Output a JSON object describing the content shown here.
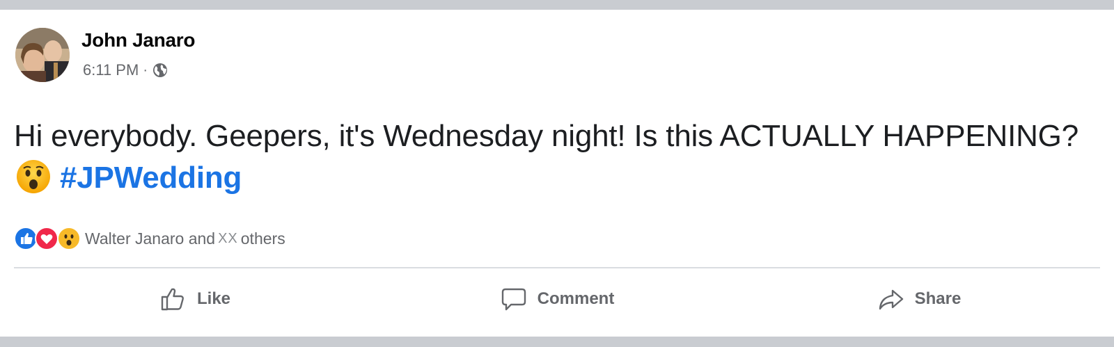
{
  "post": {
    "author": "John Janaro",
    "timestamp": "6:11 PM",
    "separator": "·",
    "privacy_icon": "globe-icon",
    "text_before": "Hi everybody. Geepers, it's Wednesday night! Is this ACTUALLY HAPPENING?",
    "inline_emoji": "astonished-face-emoji",
    "hashtag": "#JPWedding"
  },
  "reactions": {
    "icons": [
      "like-reaction-icon",
      "love-reaction-icon",
      "wow-reaction-icon"
    ],
    "summary_prefix": "Walter Janaro and",
    "count": "XX",
    "summary_suffix": "others"
  },
  "actions": {
    "like_label": "Like",
    "comment_label": "Comment",
    "share_label": "Share"
  },
  "colors": {
    "link_blue": "#1b74e4",
    "secondary_text": "#65676b",
    "love_red": "#f0284a",
    "wow_yellow": "#f7b928"
  }
}
